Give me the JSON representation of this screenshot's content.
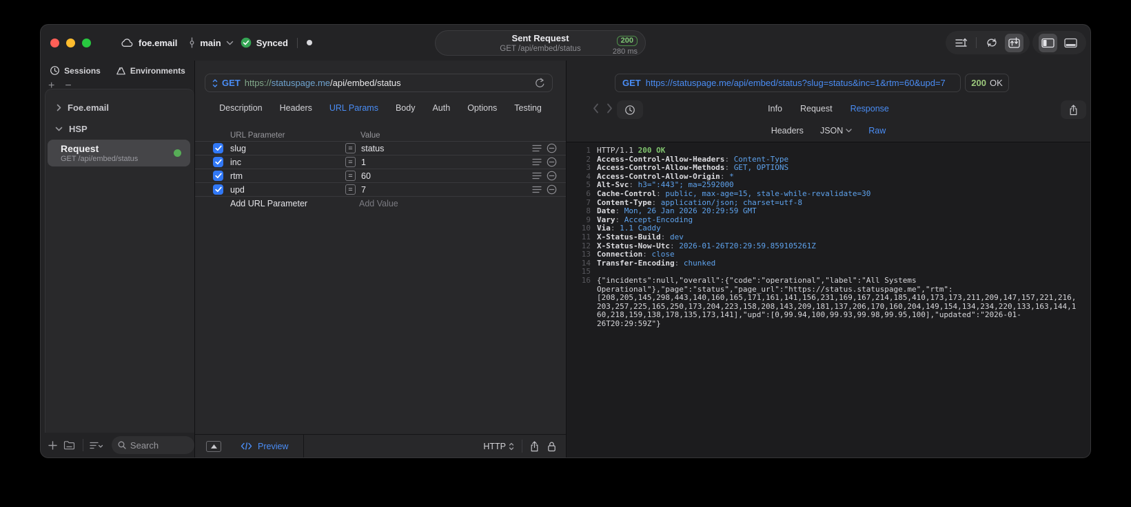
{
  "titlebar": {
    "project": "foe.email",
    "branch": "main",
    "sync_status": "Synced",
    "request_summary": {
      "title": "Sent Request",
      "subtitle": "GET /api/embed/status",
      "status_code": "200",
      "duration": "280 ms"
    }
  },
  "sidebar": {
    "tabs": [
      {
        "label": "Sessions"
      },
      {
        "label": "Environments"
      }
    ],
    "tree": [
      {
        "label": "Foe.email"
      },
      {
        "label": "HSP"
      }
    ],
    "request_item": {
      "title": "Request",
      "subtitle": "GET /api/embed/status"
    },
    "search_placeholder": "Search"
  },
  "request_panel": {
    "method": "GET",
    "url_scheme": "https://",
    "url_host": "statuspage.me",
    "url_path": "/api/embed/status",
    "tabs": [
      "Description",
      "Headers",
      "URL Params",
      "Body",
      "Auth",
      "Options",
      "Testing"
    ],
    "active_tab": "URL Params",
    "params_table": {
      "columns": {
        "name": "URL Parameter",
        "value": "Value"
      },
      "operator": "=",
      "rows": [
        {
          "enabled": true,
          "name": "slug",
          "value": "status"
        },
        {
          "enabled": true,
          "name": "inc",
          "value": "1"
        },
        {
          "enabled": true,
          "name": "rtm",
          "value": "60"
        },
        {
          "enabled": true,
          "name": "upd",
          "value": "7"
        }
      ],
      "add_param_placeholder": "Add URL Parameter",
      "add_value_placeholder": "Add Value"
    },
    "footer": {
      "preview_label": "Preview",
      "protocol_label": "HTTP"
    }
  },
  "response_panel": {
    "method": "GET",
    "request_url": "https://statuspage.me/api/embed/status?slug=status&inc=1&rtm=60&upd=7",
    "status": {
      "code": "200",
      "text": "OK"
    },
    "tabs": [
      "Info",
      "Request",
      "Response"
    ],
    "active_tab": "Response",
    "subtabs": [
      "Headers",
      "JSON",
      "Raw"
    ],
    "active_subtab": "Raw",
    "raw": {
      "status_line": {
        "protocol": "HTTP/1.1 ",
        "status": "200 OK"
      },
      "headers": [
        {
          "name": "Access-Control-Allow-Headers",
          "value": "Content-Type"
        },
        {
          "name": "Access-Control-Allow-Methods",
          "value": "GET, OPTIONS"
        },
        {
          "name": "Access-Control-Allow-Origin",
          "value": "*"
        },
        {
          "name": "Alt-Svc",
          "value": "h3=\":443\"; ma=2592000"
        },
        {
          "name": "Cache-Control",
          "value": "public, max-age=15, stale-while-revalidate=30"
        },
        {
          "name": "Content-Type",
          "value": "application/json; charset=utf-8"
        },
        {
          "name": "Date",
          "value": "Mon, 26 Jan 2026 20:29:59 GMT"
        },
        {
          "name": "Vary",
          "value": "Accept-Encoding"
        },
        {
          "name": "Via",
          "value": "1.1 Caddy"
        },
        {
          "name": "X-Status-Build",
          "value": "dev"
        },
        {
          "name": "X-Status-Now-Utc",
          "value": "2026-01-26T20:29:59.859105261Z"
        },
        {
          "name": "Connection",
          "value": "close"
        },
        {
          "name": "Transfer-Encoding",
          "value": "chunked"
        }
      ],
      "body": "{\"incidents\":null,\"overall\":{\"code\":\"operational\",\"label\":\"All Systems Operational\"},\"page\":\"status\",\"page_url\":\"https://status.statuspage.me\",\"rtm\":[208,205,145,298,443,140,160,165,171,161,141,156,231,169,167,214,185,410,173,173,211,209,147,157,221,216,203,257,225,165,250,173,204,223,158,208,143,209,181,137,206,170,160,204,149,154,134,234,220,133,163,144,160,218,159,138,178,135,173,141],\"upd\":[0,99.94,100,99.93,99.98,99.95,100],\"updated\":\"2026-01-26T20:29:59Z\"}"
    }
  }
}
